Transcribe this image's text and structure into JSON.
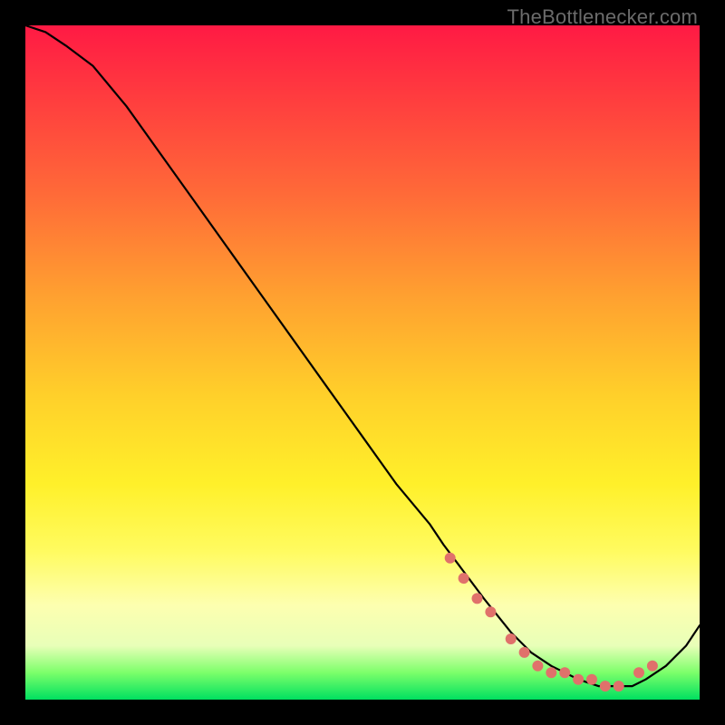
{
  "watermark": "TheBottlenecker.com",
  "colors": {
    "background": "#000000",
    "gradient_top": "#ff1a44",
    "gradient_mid1": "#ffa030",
    "gradient_mid2": "#fff02a",
    "gradient_bottom": "#00e060",
    "curve": "#000000",
    "dots": "#e0716b"
  },
  "chart_data": {
    "type": "line",
    "title": "",
    "xlabel": "",
    "ylabel": "",
    "xlim": [
      0,
      100
    ],
    "ylim": [
      0,
      100
    ],
    "grid": false,
    "x": [
      0,
      3,
      6,
      10,
      15,
      20,
      25,
      30,
      35,
      40,
      45,
      50,
      55,
      60,
      62,
      65,
      68,
      72,
      75,
      78,
      80,
      82,
      85,
      88,
      90,
      92,
      95,
      98,
      100
    ],
    "values": [
      100,
      99,
      97,
      94,
      88,
      81,
      74,
      67,
      60,
      53,
      46,
      39,
      32,
      26,
      23,
      19,
      15,
      10,
      7,
      5,
      4,
      3,
      2,
      2,
      2,
      3,
      5,
      8,
      11
    ],
    "dots_x": [
      63,
      65,
      67,
      69,
      72,
      74,
      76,
      78,
      80,
      82,
      84,
      86,
      88,
      91,
      93
    ],
    "dots_y": [
      21,
      18,
      15,
      13,
      9,
      7,
      5,
      4,
      4,
      3,
      3,
      2,
      2,
      4,
      5
    ]
  }
}
